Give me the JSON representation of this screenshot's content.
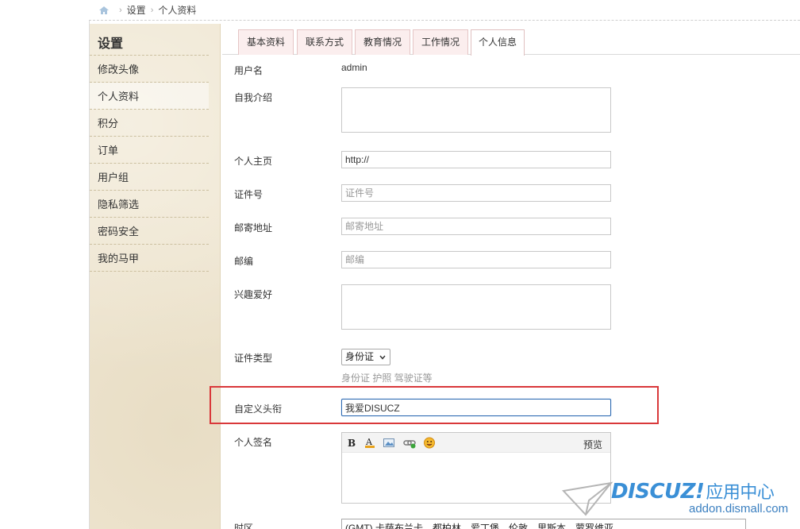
{
  "breadcrumb": {
    "items": [
      "设置",
      "个人资料"
    ]
  },
  "sidebar": {
    "title": "设置",
    "items": [
      {
        "label": "修改头像"
      },
      {
        "label": "个人资料"
      },
      {
        "label": "积分"
      },
      {
        "label": "订单"
      },
      {
        "label": "用户组"
      },
      {
        "label": "隐私筛选"
      },
      {
        "label": "密码安全"
      },
      {
        "label": "我的马甲"
      }
    ]
  },
  "tabs": [
    {
      "label": "基本资料"
    },
    {
      "label": "联系方式"
    },
    {
      "label": "教育情况"
    },
    {
      "label": "工作情况"
    },
    {
      "label": "个人信息"
    }
  ],
  "form": {
    "username": {
      "label": "用户名",
      "value": "admin"
    },
    "bio": {
      "label": "自我介绍"
    },
    "homepage": {
      "label": "个人主页",
      "value": "http://"
    },
    "idnumber": {
      "label": "证件号",
      "placeholder": "证件号"
    },
    "address": {
      "label": "邮寄地址",
      "placeholder": "邮寄地址"
    },
    "zipcode": {
      "label": "邮编",
      "placeholder": "邮编"
    },
    "interests": {
      "label": "兴趣爱好"
    },
    "idtype": {
      "label": "证件类型",
      "selected": "身份证",
      "hint": "身份证 护照 驾驶证等"
    },
    "customtitle": {
      "label": "自定义头衔",
      "value": "我爱DISUCZ"
    },
    "signature": {
      "label": "个人签名",
      "preview": "预览"
    },
    "timezone": {
      "label": "时区",
      "selected": "(GMT) 卡萨布兰卡，都柏林，爱丁堡，伦敦，里斯本，蒙罗维亚"
    }
  },
  "watermark": {
    "brand": "DISCUZ!",
    "suffix": "应用中心",
    "url": "addon.dismall.com"
  },
  "colors": {
    "highlight": "#d9383a",
    "sidebar_bg": "#efe6d1",
    "tab_bg": "#fbeeee",
    "watermark": "#3a8fd6"
  }
}
